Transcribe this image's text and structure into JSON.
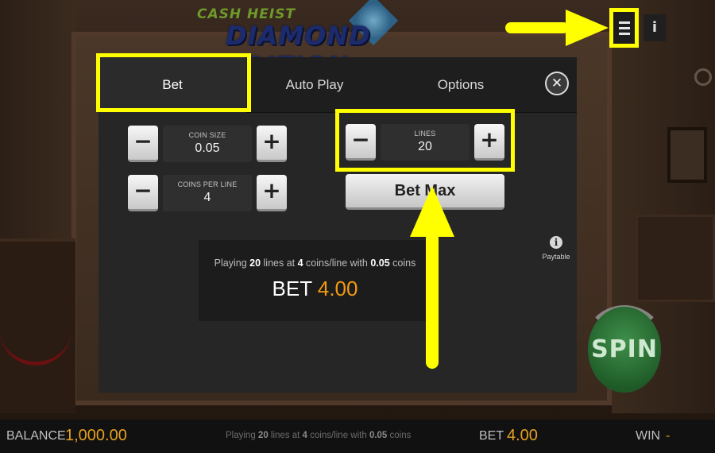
{
  "logo": {
    "line1": "CASH HEIST",
    "line2": "DIAMOND EDITION"
  },
  "top_controls": {
    "menu_icon": "hamburger-icon",
    "info_glyph": "i"
  },
  "tabs": [
    {
      "label": "Bet",
      "selected": true
    },
    {
      "label": "Auto Play",
      "selected": false
    },
    {
      "label": "Options",
      "selected": false
    }
  ],
  "close_glyph": "✕",
  "coin_size": {
    "label": "COIN SIZE",
    "value": "0.05"
  },
  "coins_per_line": {
    "label": "COINS PER LINE",
    "value": "4"
  },
  "lines": {
    "label": "LINES",
    "value": "20"
  },
  "stepper_glyphs": {
    "minus": "−",
    "plus": "+"
  },
  "bet_max_label": "Bet Max",
  "summary": {
    "pre": "Playing ",
    "lines": "20",
    "mid1": " lines at ",
    "coins": "4",
    "mid2": " coins/line with ",
    "coin_value": "0.05",
    "post": " coins",
    "bet_label": "BET",
    "bet_value": "4.00"
  },
  "paytable": {
    "icon_glyph": "i",
    "label": "Paytable"
  },
  "spin_label": "SPIN",
  "statusbar": {
    "balance_label": "BALANCE",
    "balance_value": "1,000.00",
    "info": {
      "pre": "Playing ",
      "lines": "20",
      "mid1": " lines at ",
      "coins": "4",
      "mid2": " coins/line with ",
      "coin_value": "0.05",
      "post": " coins"
    },
    "bet_label": "BET",
    "bet_value": "4.00",
    "win_label": "WIN",
    "win_value": "-"
  },
  "colors": {
    "highlight": "#ffff00",
    "accent": "#f29a12",
    "spin_green": "#2e7a38"
  }
}
